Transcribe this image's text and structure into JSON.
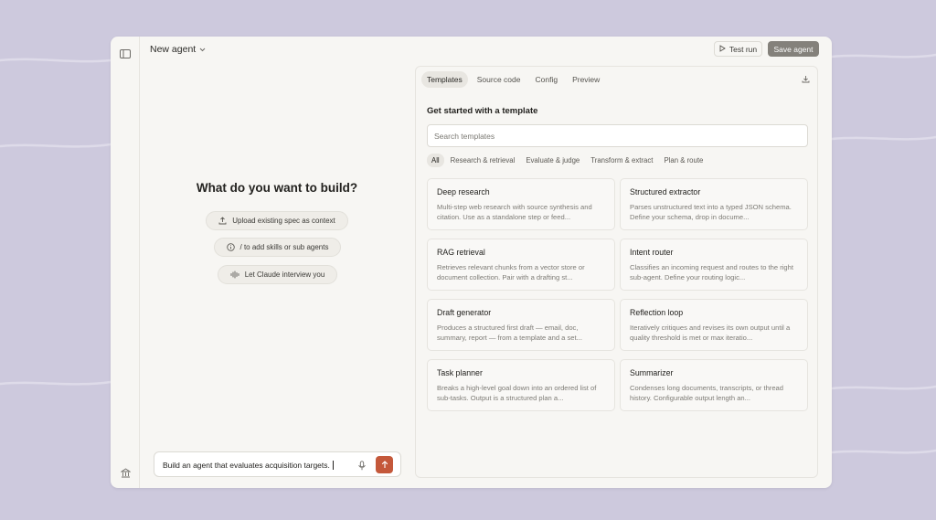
{
  "app": {
    "title": "New agent"
  },
  "toolbar": {
    "test_run_label": "Test run",
    "save_label": "Save agent"
  },
  "builder": {
    "heading": "What do you want to build?",
    "actions": [
      {
        "label": "Upload existing spec as context",
        "icon": "upload-icon"
      },
      {
        "label": "/ to add skills or sub agents",
        "icon": "info-icon"
      },
      {
        "label": "Let Claude interview you",
        "icon": "waveform-icon"
      }
    ],
    "chat_value": "Build an agent that evaluates acquisition targets."
  },
  "panel": {
    "tabs": [
      {
        "label": "Templates",
        "active": true
      },
      {
        "label": "Source code",
        "active": false
      },
      {
        "label": "Config",
        "active": false
      },
      {
        "label": "Preview",
        "active": false
      }
    ],
    "heading": "Get started with a template",
    "search_placeholder": "Search templates",
    "filters": [
      {
        "label": "All",
        "active": true
      },
      {
        "label": "Research & retrieval",
        "active": false
      },
      {
        "label": "Evaluate & judge",
        "active": false
      },
      {
        "label": "Transform & extract",
        "active": false
      },
      {
        "label": "Plan & route",
        "active": false
      }
    ],
    "templates": [
      {
        "title": "Deep research",
        "description": "Multi-step web research with source synthesis and citation. Use as a standalone step or feed..."
      },
      {
        "title": "Structured extractor",
        "description": "Parses unstructured text into a typed JSON schema. Define your schema, drop in docume..."
      },
      {
        "title": "RAG retrieval",
        "description": "Retrieves relevant chunks from a vector store or document collection. Pair with a drafting st..."
      },
      {
        "title": "Intent router",
        "description": "Classifies an incoming request and routes to the right sub-agent. Define your routing logic..."
      },
      {
        "title": "Draft generator",
        "description": "Produces a structured first draft — email, doc, summary, report — from a template and a set..."
      },
      {
        "title": "Reflection loop",
        "description": "Iteratively critiques and revises its own output until a quality threshold is met or max iteratio..."
      },
      {
        "title": "Task planner",
        "description": "Breaks a high-level goal down into an ordered list of sub-tasks. Output is a structured plan a..."
      },
      {
        "title": "Summarizer",
        "description": "Condenses long documents, transcripts, or thread history. Configurable output length an..."
      }
    ]
  },
  "colors": {
    "background": "#cdc9dd",
    "window": "#f7f6f3",
    "send_button": "#c4583a",
    "save_button": "#84817b"
  }
}
